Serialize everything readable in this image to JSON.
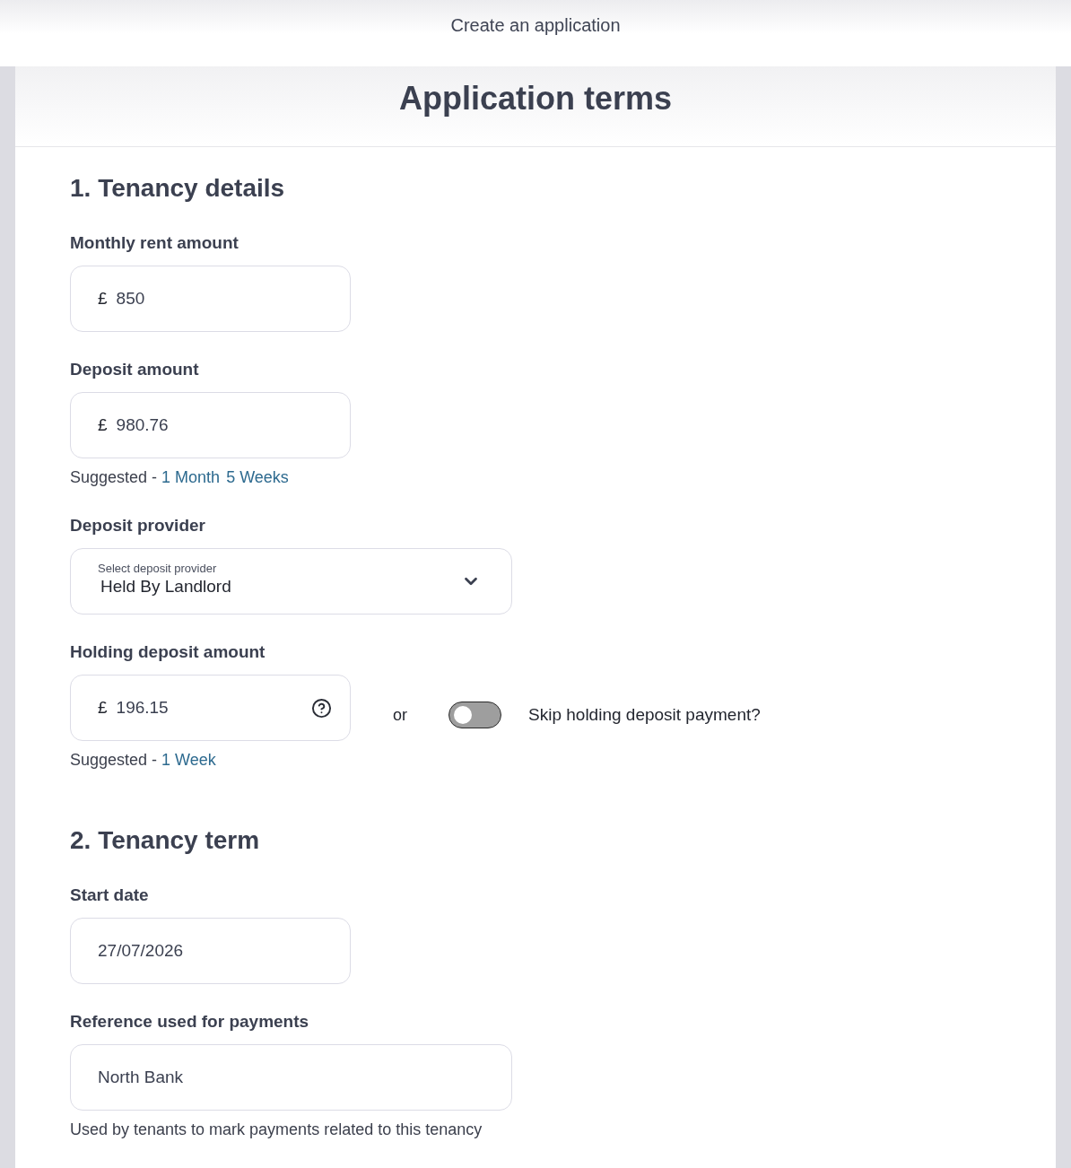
{
  "header": {
    "title": "Create an application"
  },
  "page": {
    "title": "Application terms"
  },
  "sections": [
    {
      "heading": "1. Tenancy details",
      "fields": [
        {
          "kind": "money",
          "label": "Monthly rent amount",
          "currency": "£",
          "value": "850"
        },
        {
          "kind": "money",
          "label": "Deposit amount",
          "currency": "£",
          "value": "980.76",
          "suggestions": {
            "prefix": "Suggested -",
            "links": [
              "1 Month",
              "5 Weeks"
            ]
          }
        },
        {
          "kind": "select",
          "label": "Deposit provider",
          "floating_label": "Select deposit provider",
          "value": "Held By Landlord"
        },
        {
          "kind": "money",
          "label": "Holding deposit amount",
          "currency": "£",
          "value": "196.15",
          "help": true,
          "alternative": {
            "separator": "or",
            "toggle_label": "Skip holding deposit payment?",
            "on": false
          },
          "suggestions": {
            "prefix": "Suggested -",
            "links": [
              "1 Week"
            ]
          }
        }
      ]
    },
    {
      "heading": "2. Tenancy term",
      "fields": [
        {
          "kind": "date",
          "label": "Start date",
          "value": "27/07/2026"
        },
        {
          "kind": "text",
          "label": "Reference used for payments",
          "value": "North Bank",
          "hint": "Used by tenants to mark payments related to this tenancy"
        }
      ]
    }
  ]
}
